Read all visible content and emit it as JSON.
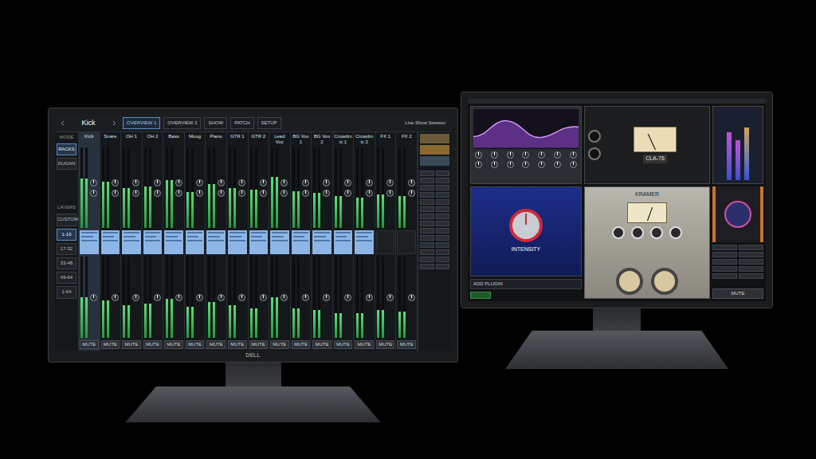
{
  "monitors": {
    "logo": "DELL"
  },
  "console": {
    "channel_selector": {
      "name": "Kick"
    },
    "tabs": [
      {
        "label": "OVERVIEW 1",
        "selected": true
      },
      {
        "label": "OVERVIEW 2",
        "selected": false
      },
      {
        "label": "SHOW",
        "selected": false
      },
      {
        "label": "PATCH",
        "selected": false
      },
      {
        "label": "SETUP",
        "selected": false
      }
    ],
    "session": "Live Show Session",
    "mode": {
      "label": "MODE",
      "items": [
        {
          "label": "RACKS",
          "selected": true
        },
        {
          "label": "DUGAN",
          "selected": false
        }
      ]
    },
    "layers": {
      "label": "LAYERS",
      "items": [
        {
          "label": "CUSTOM",
          "selected": false
        },
        {
          "label": "1-16",
          "selected": true
        },
        {
          "label": "17-32",
          "selected": false
        },
        {
          "label": "33-48",
          "selected": false
        },
        {
          "label": "49-64",
          "selected": false
        },
        {
          "label": "1-64",
          "selected": false
        }
      ]
    },
    "mute_label": "MUTE",
    "channels": [
      {
        "name": "Kick",
        "selected": true,
        "rack": true,
        "level": 0.62,
        "out_level": 0.5
      },
      {
        "name": "Snare",
        "selected": false,
        "rack": true,
        "level": 0.58,
        "out_level": 0.46
      },
      {
        "name": "OH 1",
        "selected": false,
        "rack": true,
        "level": 0.5,
        "out_level": 0.4
      },
      {
        "name": "OH 2",
        "selected": false,
        "rack": true,
        "level": 0.52,
        "out_level": 0.42
      },
      {
        "name": "Bass",
        "selected": false,
        "rack": true,
        "level": 0.6,
        "out_level": 0.48
      },
      {
        "name": "Moog",
        "selected": false,
        "rack": true,
        "level": 0.45,
        "out_level": 0.38
      },
      {
        "name": "Piano",
        "selected": false,
        "rack": true,
        "level": 0.55,
        "out_level": 0.44
      },
      {
        "name": "GTR 1",
        "selected": false,
        "rack": true,
        "level": 0.5,
        "out_level": 0.4
      },
      {
        "name": "GTR 2",
        "selected": false,
        "rack": true,
        "level": 0.48,
        "out_level": 0.36
      },
      {
        "name": "Lead Voc",
        "selected": false,
        "rack": true,
        "level": 0.64,
        "out_level": 0.5
      },
      {
        "name": "BG Vox 1",
        "selected": false,
        "rack": true,
        "level": 0.46,
        "out_level": 0.36
      },
      {
        "name": "BG Vox 2",
        "selected": false,
        "rack": true,
        "level": 0.44,
        "out_level": 0.34
      },
      {
        "name": "Crowdmic 1",
        "selected": false,
        "rack": true,
        "level": 0.4,
        "out_level": 0.3
      },
      {
        "name": "Crowdmic 2",
        "selected": false,
        "rack": true,
        "level": 0.38,
        "out_level": 0.3
      },
      {
        "name": "FX 1",
        "selected": false,
        "rack": false,
        "level": 0.42,
        "out_level": 0.34
      },
      {
        "name": "FX 2",
        "selected": false,
        "rack": false,
        "level": 0.4,
        "out_level": 0.32
      }
    ]
  },
  "plugin_rack": {
    "compressor": {
      "name": "CLA-76"
    },
    "tape": {
      "name": "KRAMER"
    },
    "saturator": {
      "label": "INTENSITY"
    },
    "add_plugin": "ADD PLUGIN",
    "mute_label": "MUTE"
  }
}
